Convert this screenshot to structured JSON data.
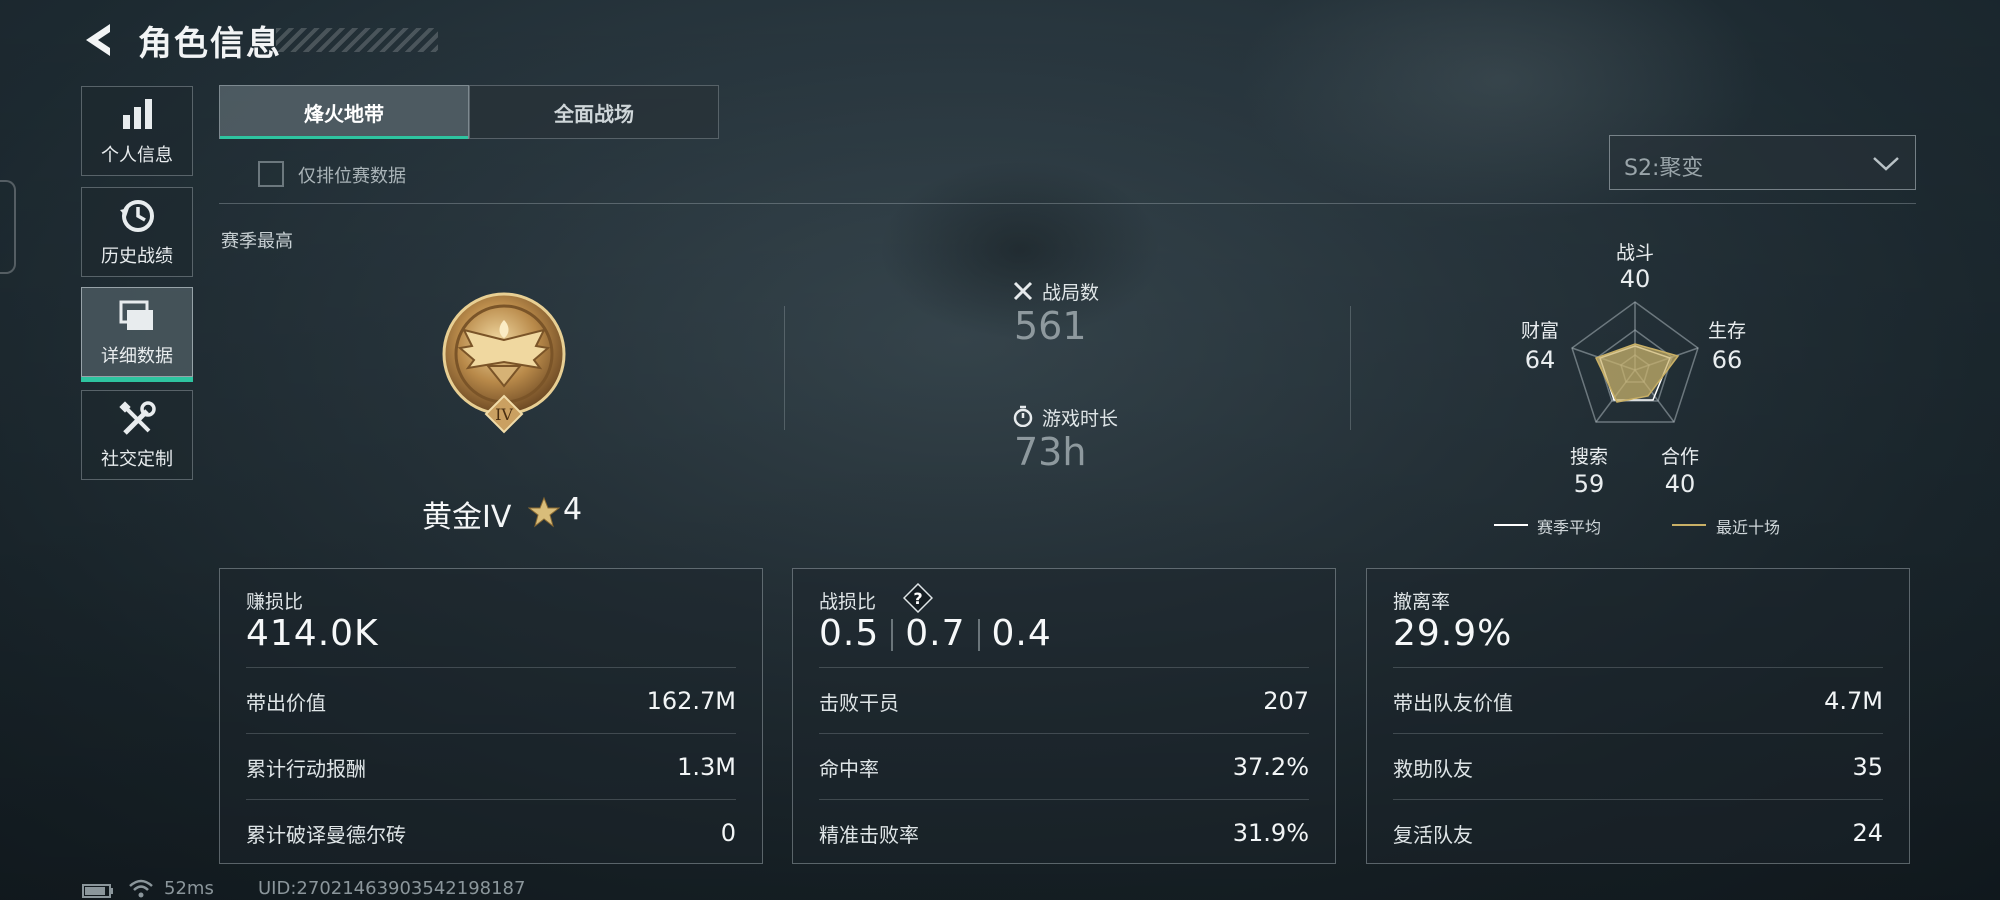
{
  "header": {
    "title": "角色信息"
  },
  "sidebar": {
    "items": [
      {
        "label": "个人信息",
        "icon": "bar-chart-icon"
      },
      {
        "label": "历史战绩",
        "icon": "history-clock-icon"
      },
      {
        "label": "详细数据",
        "icon": "folders-icon",
        "active": true
      },
      {
        "label": "社交定制",
        "icon": "tools-icon"
      }
    ]
  },
  "tabs": [
    {
      "label": "烽火地带",
      "active": true
    },
    {
      "label": "全面战场",
      "active": false
    }
  ],
  "filter": {
    "ranked_only_label": "仅排位赛数据",
    "checked": false
  },
  "season_select": {
    "value": "S2:聚变"
  },
  "season_best": {
    "section_label": "赛季最高",
    "rank": "黄金IV",
    "medal_numeral": "IV",
    "stars": "4"
  },
  "stats": {
    "matches_label": "战局数",
    "matches_value": "561",
    "playtime_label": "游戏时长",
    "playtime_value": "73h"
  },
  "radar": {
    "labels": {
      "combat": "战斗",
      "survival": "生存",
      "cooperation": "合作",
      "search": "搜索",
      "wealth": "财富"
    },
    "values": {
      "combat": "40",
      "survival": "66",
      "cooperation": "40",
      "search": "59",
      "wealth": "64"
    },
    "legend": {
      "season_avg": "赛季平均",
      "recent_ten": "最近十场"
    },
    "colors": {
      "season_avg": "#ffffff",
      "recent_ten": "#c9b066"
    }
  },
  "cards": {
    "profit": {
      "title": "赚损比",
      "value": "414.0K",
      "rows": [
        {
          "label": "带出价值",
          "value": "162.7M"
        },
        {
          "label": "累计行动报酬",
          "value": "1.3M"
        },
        {
          "label": "累计破译曼德尔砖",
          "value": "0"
        }
      ]
    },
    "kd": {
      "title": "战损比",
      "values": [
        "0.5",
        "0.7",
        "0.4"
      ],
      "rows": [
        {
          "label": "击败干员",
          "value": "207"
        },
        {
          "label": "命中率",
          "value": "37.2%"
        },
        {
          "label": "精准击败率",
          "value": "31.9%"
        }
      ]
    },
    "extract": {
      "title": "撤离率",
      "value": "29.9%",
      "rows": [
        {
          "label": "带出队友价值",
          "value": "4.7M"
        },
        {
          "label": "救助队友",
          "value": "35"
        },
        {
          "label": "复活队友",
          "value": "24"
        }
      ]
    }
  },
  "footer": {
    "ping": "52ms",
    "uid": "UID:27021463903542198187"
  },
  "colors": {
    "accent": "#2ec4a0",
    "gold": "#c9a35a"
  }
}
